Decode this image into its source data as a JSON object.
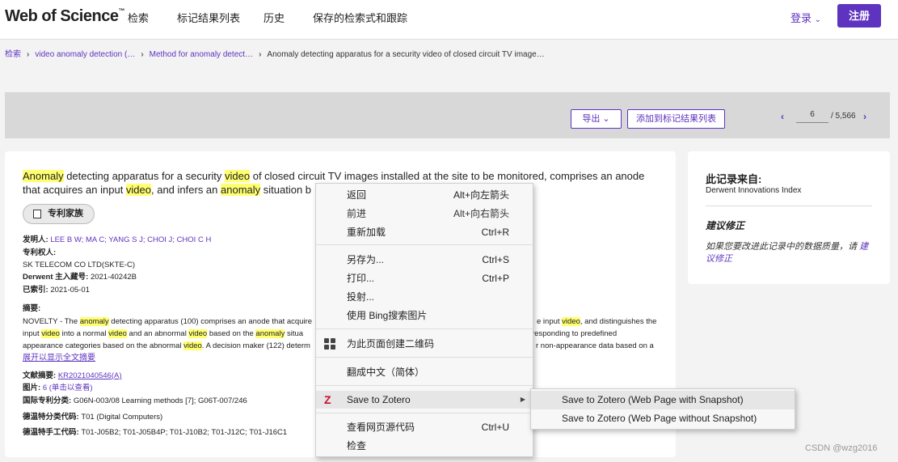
{
  "header": {
    "logo": "Web of Science",
    "logo_tm": "™",
    "nav": [
      "检索",
      "标记结果列表",
      "历史",
      "保存的检索式和跟踪"
    ],
    "login": "登录",
    "login_chevron": "⌄",
    "register": "注册"
  },
  "breadcrumb": {
    "items": [
      "检索",
      "video anomaly detection (…",
      "Method for anomaly detect…",
      "Anomaly detecting apparatus for a security video of closed circuit TV image…"
    ],
    "separator": "›"
  },
  "toolbar": {
    "export": "导出",
    "export_chevron": "⌄",
    "add_marked": "添加到标记结果列表",
    "prev": "‹",
    "page": "6",
    "total": "/ 5,566",
    "next": "›"
  },
  "record": {
    "title_parts": [
      {
        "text": "Anomaly",
        "hl": true
      },
      {
        "text": " detecting apparatus for a security ",
        "hl": false
      },
      {
        "text": "video",
        "hl": true
      },
      {
        "text": " of closed circuit TV images installed at the site to be monitored, comprises an anode that acquires an input ",
        "hl": false
      },
      {
        "text": "video",
        "hl": true
      },
      {
        "text": ", and infers an ",
        "hl": false
      },
      {
        "text": "anomaly",
        "hl": true
      },
      {
        "text": " situation b",
        "hl": false
      }
    ],
    "family_button": "专利家族",
    "inventor_label": "发明人:",
    "inventors": "LEE B W; MA C; YANG S J; CHOI J; CHOI C H",
    "assignee_label": "专利权人:",
    "assignee": "SK TELECOM CO LTD(SKTE-C)",
    "derwent_label": "Derwent 主入藏号:",
    "derwent": "2021-40242B",
    "indexed_label": "已索引:",
    "indexed": "2021-05-01",
    "abstract_label": "摘要:",
    "abstract_line1": [
      {
        "text": "NOVELTY - The ",
        "hl": false
      },
      {
        "text": "anomaly",
        "hl": true
      },
      {
        "text": " detecting apparatus (100) comprises an anode that acquire",
        "hl": false
      }
    ],
    "abstract_line1_tail": [
      {
        "text": "e input ",
        "hl": false
      },
      {
        "text": "video",
        "hl": true
      },
      {
        "text": ", and distinguishes the",
        "hl": false
      }
    ],
    "abstract_line2": [
      {
        "text": "input ",
        "hl": false
      },
      {
        "text": "video",
        "hl": true
      },
      {
        "text": " into a normal ",
        "hl": false
      },
      {
        "text": "video",
        "hl": true
      },
      {
        "text": " and an abnormal ",
        "hl": false
      },
      {
        "text": "video",
        "hl": true
      },
      {
        "text": " based on the ",
        "hl": false
      },
      {
        "text": "anomaly",
        "hl": true
      },
      {
        "text": " situa",
        "hl": false
      }
    ],
    "abstract_line2_tail": "responding to predefined",
    "abstract_line3": [
      {
        "text": "appearance categories based on the abnormal ",
        "hl": false
      },
      {
        "text": "video",
        "hl": true
      },
      {
        "text": ". A decision maker (122) determ",
        "hl": false
      }
    ],
    "abstract_line3_tail": "r non-appearance data based on a",
    "expand": "展开以显示全文摘要",
    "doc_abstract_label": "文献摘要:",
    "doc_abstract": "KR2021040546(A)",
    "images_label": "图片:",
    "images": "6 (单击以查看)",
    "ipc_label": "国际专利分类:",
    "ipc": "G06N-003/08 Learning methods [7]; G06T-007/246",
    "dcc_label": "德温特分类代码:",
    "dcc": "T01 (Digital Computers)",
    "dmc_label": "德温特手工代码:",
    "dmc": "T01-J05B2; T01-J05B4P; T01-J10B2; T01-J12C; T01-J16C1"
  },
  "side": {
    "source_heading": "此记录来自:",
    "source": "Derwent Innovations Index",
    "suggest_heading": "建议修正",
    "suggest_text": "如果您要改进此记录中的数据质量，请",
    "suggest_link": "建议修正"
  },
  "context_menu": {
    "items": [
      {
        "label": "返回",
        "key": "Alt+向左箭头"
      },
      {
        "label": "前进",
        "key": "Alt+向右箭头"
      },
      {
        "label": "重新加载",
        "key": "Ctrl+R"
      },
      {
        "label": "另存为...",
        "key": "Ctrl+S"
      },
      {
        "label": "打印...",
        "key": "Ctrl+P"
      },
      {
        "label": "投射...",
        "key": ""
      },
      {
        "label": "使用 Bing搜索图片",
        "key": ""
      },
      {
        "label": "为此页面创建二维码",
        "key": ""
      },
      {
        "label": "翻成中文（简体）",
        "key": ""
      },
      {
        "label": "Save to Zotero",
        "key": ""
      },
      {
        "label": "查看网页源代码",
        "key": "Ctrl+U"
      },
      {
        "label": "检查",
        "key": ""
      }
    ],
    "zotero_icon": "Z",
    "submenu_arrow": "▶"
  },
  "submenu": {
    "items": [
      "Save to Zotero (Web Page with Snapshot)",
      "Save to Zotero (Web Page without Snapshot)"
    ]
  },
  "watermark": "CSDN @wzg2016",
  "colors": {
    "accent": "#5e33bf",
    "highlight": "#ffff70"
  }
}
